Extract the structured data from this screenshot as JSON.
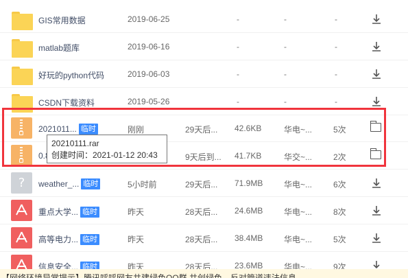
{
  "rows": [
    {
      "name": "GIS常用数据",
      "date": "2019-06-25",
      "kind": "folder"
    },
    {
      "name": "matlab题库",
      "date": "2019-06-16",
      "kind": "folder"
    },
    {
      "name": "好玩的python代码",
      "date": "2019-06-03",
      "kind": "folder"
    },
    {
      "name": "CSDN下载资料",
      "date": "2019-05-26",
      "kind": "folder"
    },
    {
      "name": "2021011...",
      "tag": "临时",
      "date": "刚刚",
      "expire": "29天后...",
      "size": "42.6KB",
      "source": "华电~...",
      "count": "5次",
      "kind": "zip"
    },
    {
      "name": "0.8",
      "date": "",
      "expire": "9天后到...",
      "size": "41.7KB",
      "source": "华交~...",
      "count": "2次",
      "kind": "zip"
    },
    {
      "name": "weather_...",
      "tag": "临时",
      "date": "5小时前",
      "expire": "29天后...",
      "size": "71.9MB",
      "source": "华电~...",
      "count": "6次",
      "kind": "unknown"
    },
    {
      "name": "重点大学...",
      "tag": "临时",
      "date": "昨天",
      "expire": "28天后...",
      "size": "24.6MB",
      "source": "华电~...",
      "count": "8次",
      "kind": "pdf"
    },
    {
      "name": "高等电力...",
      "tag": "临时",
      "date": "昨天",
      "expire": "28天后...",
      "size": "38.4MB",
      "source": "华电~...",
      "count": "5次",
      "kind": "pdf"
    },
    {
      "name": "信息安全...",
      "tag": "临时",
      "date": "昨天",
      "expire": "28天后...",
      "size": "23.6MB",
      "source": "华电~...",
      "count": "9次",
      "kind": "pdf"
    }
  ],
  "dash": "-",
  "tooltip": {
    "filename": "20210111.rar",
    "created": "创建时间：2021-01-12 20:43"
  },
  "notice": "【网络环境异常提示】腾讯呼呼网友共建绿色QQ群 共创绿色、反对管道违法信息",
  "colors": {
    "highlight": "#f0343c",
    "tag": "#3b8cff",
    "folder": "#fbd456",
    "zip": "#f7b366",
    "pdf": "#f05f5f"
  }
}
